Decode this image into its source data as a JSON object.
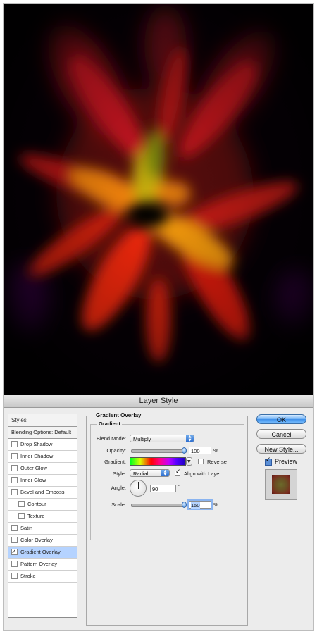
{
  "dialog": {
    "title": "Layer Style"
  },
  "styles_panel": {
    "header": "Styles",
    "blending_options": "Blending Options: Default",
    "items": [
      {
        "label": "Drop Shadow",
        "checked": false,
        "sub": false,
        "selected": false
      },
      {
        "label": "Inner Shadow",
        "checked": false,
        "sub": false,
        "selected": false
      },
      {
        "label": "Outer Glow",
        "checked": false,
        "sub": false,
        "selected": false
      },
      {
        "label": "Inner Glow",
        "checked": false,
        "sub": false,
        "selected": false
      },
      {
        "label": "Bevel and Emboss",
        "checked": false,
        "sub": false,
        "selected": false
      },
      {
        "label": "Contour",
        "checked": false,
        "sub": true,
        "selected": false
      },
      {
        "label": "Texture",
        "checked": false,
        "sub": true,
        "selected": false
      },
      {
        "label": "Satin",
        "checked": false,
        "sub": false,
        "selected": false
      },
      {
        "label": "Color Overlay",
        "checked": false,
        "sub": false,
        "selected": false
      },
      {
        "label": "Gradient Overlay",
        "checked": true,
        "sub": false,
        "selected": true
      },
      {
        "label": "Pattern Overlay",
        "checked": false,
        "sub": false,
        "selected": false
      },
      {
        "label": "Stroke",
        "checked": false,
        "sub": false,
        "selected": false
      }
    ]
  },
  "gradient_overlay": {
    "group_title": "Gradient Overlay",
    "subgroup_title": "Gradient",
    "blend_mode_label": "Blend Mode:",
    "blend_mode_value": "Multiply",
    "opacity_label": "Opacity:",
    "opacity_value": "100",
    "opacity_fraction": 1.0,
    "opacity_unit": "%",
    "gradient_label": "Gradient:",
    "reverse_label": "Reverse",
    "reverse_checked": false,
    "style_label": "Style:",
    "style_value": "Radial",
    "align_label": "Align with Layer",
    "align_checked": true,
    "angle_label": "Angle:",
    "angle_value": "90",
    "angle_unit": "°",
    "scale_label": "Scale:",
    "scale_value": "150",
    "scale_fraction": 1.0,
    "scale_unit": "%"
  },
  "buttons": {
    "ok": "OK",
    "cancel": "Cancel",
    "new_style": "New Style...",
    "preview_label": "Preview",
    "preview_checked": true
  }
}
